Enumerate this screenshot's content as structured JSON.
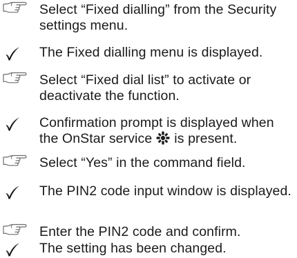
{
  "instructions": {
    "steps": [
      {
        "kind": "action",
        "icon": "pointing-hand-icon",
        "text": "Select “Fixed dialling” from the Security settings menu."
      },
      {
        "kind": "result",
        "icon": "checkmark-icon",
        "text": "The Fixed dialling menu is displayed."
      },
      {
        "kind": "action",
        "icon": "pointing-hand-icon",
        "text": "Select “Fixed dial list” to activate or deactivate the function."
      },
      {
        "kind": "result",
        "icon": "checkmark-icon",
        "text_before": "Confirmation prompt is displayed when the OnStar service",
        "inline_icon": "onstar-service-icon",
        "text_after": "is present."
      },
      {
        "kind": "action",
        "icon": "pointing-hand-icon",
        "text": "Select “Yes” in the command field."
      },
      {
        "kind": "result",
        "icon": "checkmark-icon",
        "text": "The PIN2 code input window is displayed."
      },
      {
        "kind": "action",
        "icon": "pointing-hand-icon",
        "text": "Enter the PIN2 code and confirm."
      },
      {
        "kind": "result",
        "icon": "checkmark-icon",
        "text": "The setting has been changed."
      }
    ]
  }
}
